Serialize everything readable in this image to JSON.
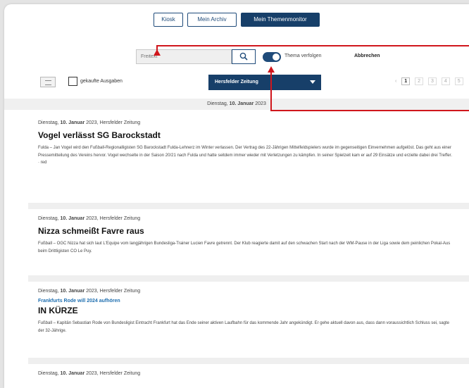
{
  "tabs": [
    {
      "label": "Kiosk"
    },
    {
      "label": "Mein Archiv"
    },
    {
      "label": "Mein Themenmonitor"
    }
  ],
  "search": {
    "placeholder": "Freitext"
  },
  "toggle_label": "Thema verfolgen",
  "cancel_label": "Abbrechen",
  "checkbox_label": "gekaufte Ausgaben",
  "paper_select": "Hersfelder Zeitung",
  "pagination": [
    "‹",
    "1",
    "2",
    "3",
    "4",
    "5"
  ],
  "date_bar": {
    "weekday": "Dienstag,",
    "day": "10. Januar",
    "year": "2023"
  },
  "articles": [
    {
      "meta_weekday": "Dienstag,",
      "meta_day": "10. Januar",
      "meta_rest": "2023, Hersfelder Zeitung",
      "kicker": "",
      "title": "Vogel verlässt SG Barockstadt",
      "body": "Fulda – Jan Vogel wird den Fußball-Regionalligisten SG Barockstadt Fulda-Lehnerz im Winter verlassen. Der Vertrag des 22-Jährigen Mittelfeldspielers wurde im gegenseitigen Einvernehmen aufgelöst. Das geht aus einer Pressemitteilung des Vereins hervor. Vogel wechselte in der Saison 20/21 nach Fulda und hatte seitdem immer wieder mit Verletzungen zu kämpfen. In seiner Spielzeit kam er auf 29 Einsätze und erzielte dabei drei Treffer. · red"
    },
    {
      "meta_weekday": "Dienstag,",
      "meta_day": "10. Januar",
      "meta_rest": "2023, Hersfelder Zeitung",
      "kicker": "",
      "title": "Nizza schmeißt Favre raus",
      "body": "Fußball – OGC Nizza hat sich laut L'Equipe vom langjährigen Bundesliga-Trainer Lucien Favre getrennt. Der Klub reagierte damit auf den schwachen Start nach der WM-Pause in der Liga sowie dem peinlichen Pokal-Aus beim Drittligisten CO Le Puy."
    },
    {
      "meta_weekday": "Dienstag,",
      "meta_day": "10. Januar",
      "meta_rest": "2023, Hersfelder Zeitung",
      "kicker": "Frankfurts Rode will 2024 aufhören",
      "title": "IN KÜRZE",
      "body": "Fußball – Kapitän Sebastian Rode von Bundesligist Eintracht Frankfurt hat das Ende seiner aktiven Laufbahn für das kommende Jahr angekündigt. Er gehe aktuell davon aus, dass dann voraussichtlich Schluss sei, sagte der 32-Jährige."
    },
    {
      "meta_weekday": "Dienstag,",
      "meta_day": "10. Januar",
      "meta_rest": "2023, Hersfelder Zeitung"
    }
  ]
}
